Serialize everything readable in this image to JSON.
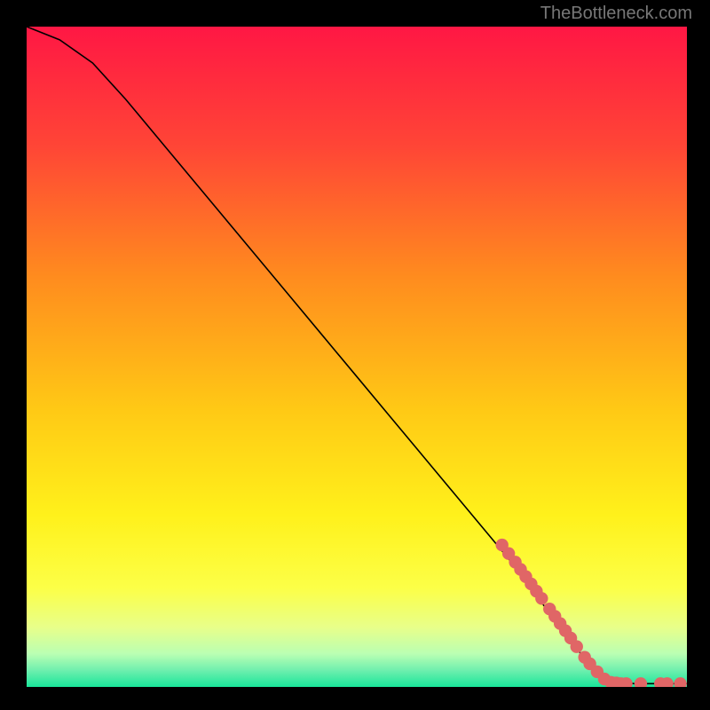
{
  "watermark": "TheBottleneck.com",
  "chart_data": {
    "type": "line",
    "title": "",
    "xlabel": "",
    "ylabel": "",
    "xlim": [
      0,
      100
    ],
    "ylim": [
      0,
      100
    ],
    "curve": {
      "x": [
        0,
        5,
        10,
        15,
        20,
        25,
        30,
        35,
        40,
        45,
        50,
        55,
        60,
        65,
        70,
        75,
        80,
        82,
        85,
        88,
        90,
        92,
        95,
        98,
        100
      ],
      "y": [
        100,
        98,
        94.5,
        89,
        83,
        77,
        71,
        65,
        59,
        53,
        47,
        41,
        35,
        29,
        23,
        17,
        10,
        7,
        4,
        1.5,
        0.8,
        0.5,
        0.5,
        0.5,
        0.5
      ]
    },
    "markers": [
      {
        "x": 72,
        "y": 21.5
      },
      {
        "x": 73,
        "y": 20.2
      },
      {
        "x": 74,
        "y": 18.9
      },
      {
        "x": 74.8,
        "y": 17.8
      },
      {
        "x": 75.6,
        "y": 16.7
      },
      {
        "x": 76.4,
        "y": 15.6
      },
      {
        "x": 77.2,
        "y": 14.5
      },
      {
        "x": 78,
        "y": 13.4
      },
      {
        "x": 79.2,
        "y": 11.8
      },
      {
        "x": 80,
        "y": 10.7
      },
      {
        "x": 80.8,
        "y": 9.6
      },
      {
        "x": 81.6,
        "y": 8.5
      },
      {
        "x": 82.4,
        "y": 7.4
      },
      {
        "x": 83.3,
        "y": 6.1
      },
      {
        "x": 84.5,
        "y": 4.5
      },
      {
        "x": 85.3,
        "y": 3.5
      },
      {
        "x": 86.4,
        "y": 2.3
      },
      {
        "x": 87.5,
        "y": 1.2
      },
      {
        "x": 88.5,
        "y": 0.7
      },
      {
        "x": 89.3,
        "y": 0.6
      },
      {
        "x": 90,
        "y": 0.5
      },
      {
        "x": 90.8,
        "y": 0.5
      },
      {
        "x": 93,
        "y": 0.5
      },
      {
        "x": 96,
        "y": 0.5
      },
      {
        "x": 97,
        "y": 0.5
      },
      {
        "x": 99,
        "y": 0.5
      }
    ],
    "marker_color": "#e06666",
    "gradient_stops": [
      {
        "offset": 0,
        "color": "#ff1744"
      },
      {
        "offset": 18,
        "color": "#ff4536"
      },
      {
        "offset": 38,
        "color": "#ff8c1e"
      },
      {
        "offset": 58,
        "color": "#ffc915"
      },
      {
        "offset": 74,
        "color": "#fff11b"
      },
      {
        "offset": 85,
        "color": "#fcff47"
      },
      {
        "offset": 91,
        "color": "#e8ff8a"
      },
      {
        "offset": 95,
        "color": "#baffb3"
      },
      {
        "offset": 97.5,
        "color": "#6eefae"
      },
      {
        "offset": 100,
        "color": "#19e69a"
      }
    ]
  }
}
